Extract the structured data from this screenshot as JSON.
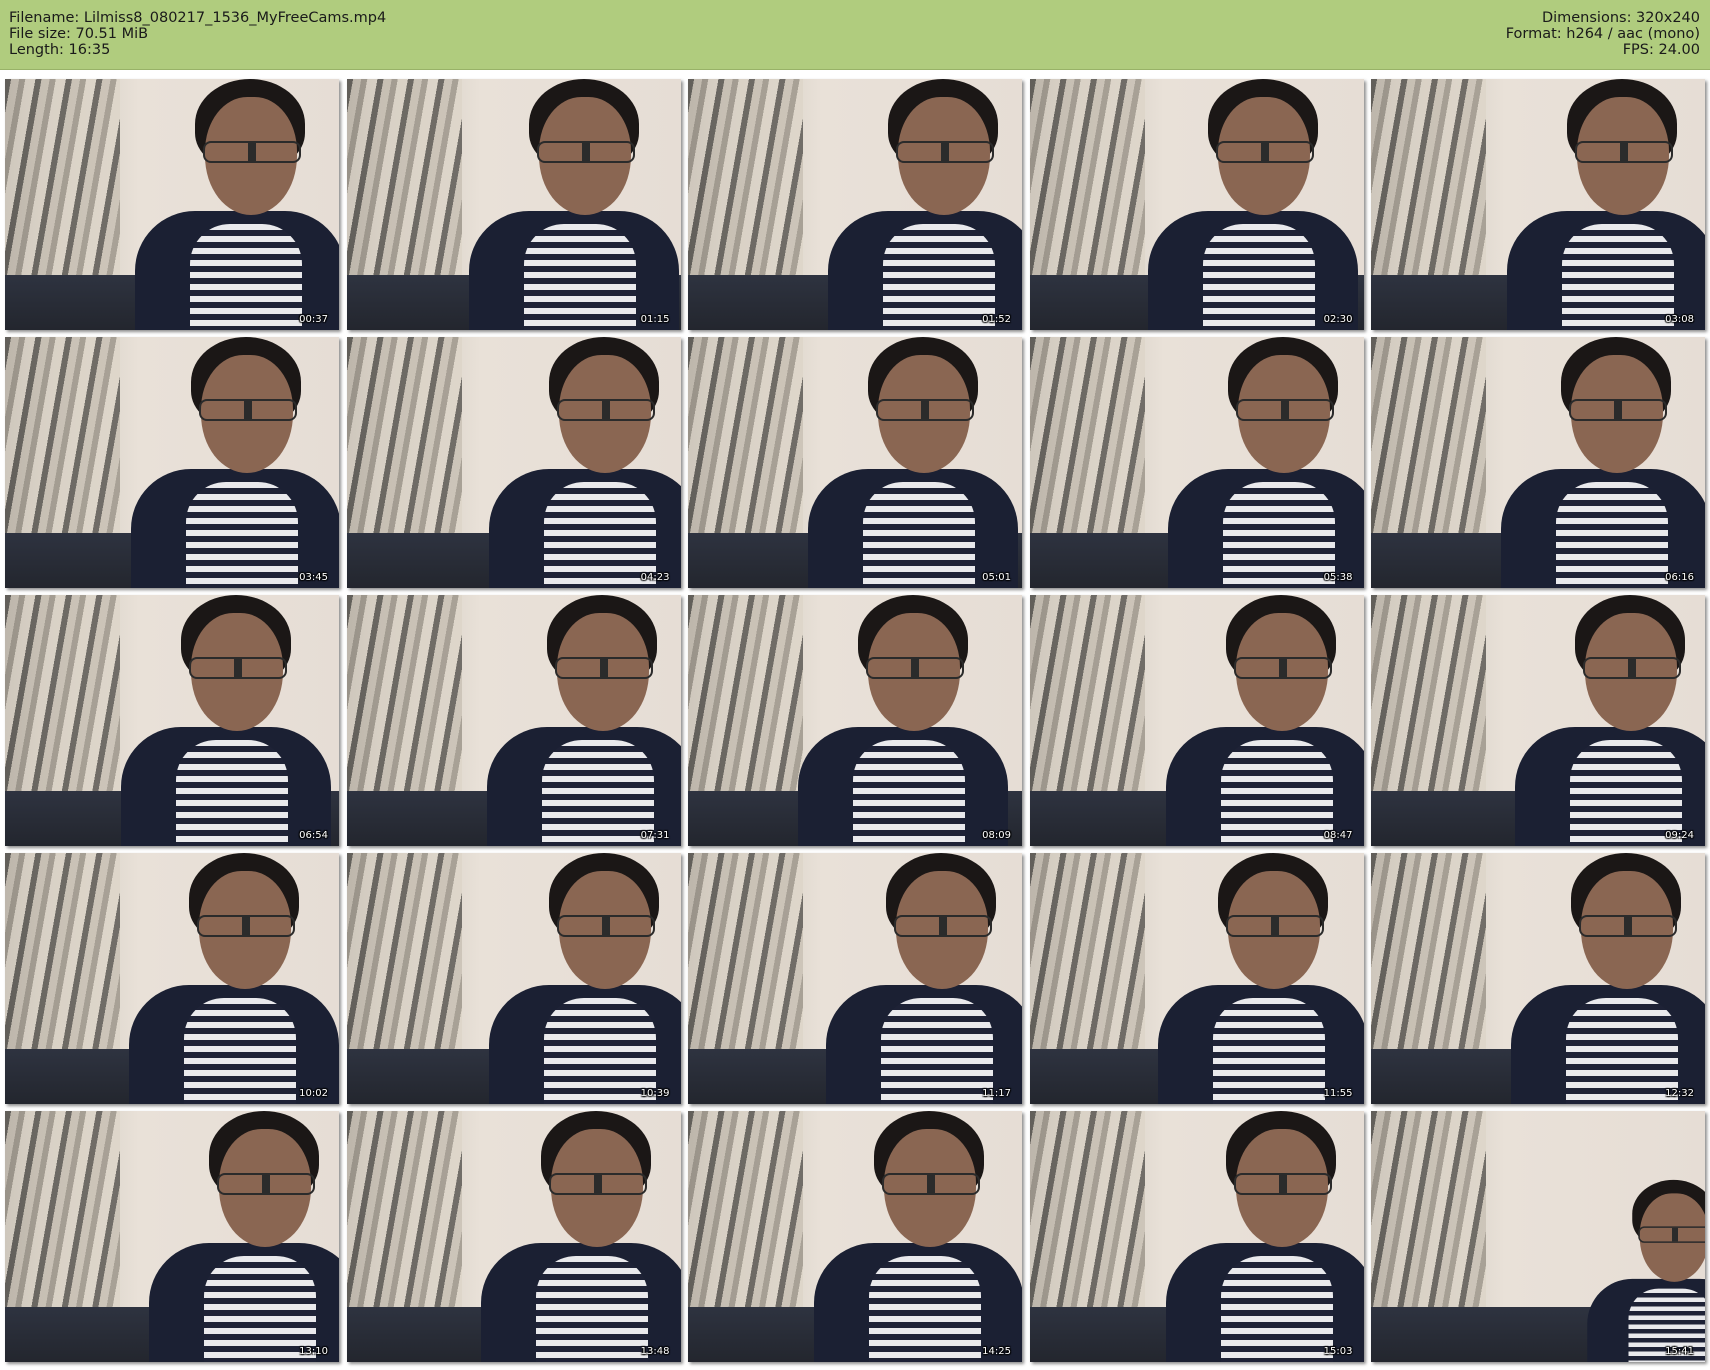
{
  "header": {
    "filename": "Filename: Lilmiss8_080217_1536_MyFreeCams.mp4",
    "file_size": "File size: 70.51 MiB",
    "length": "Length: 16:35",
    "dimensions": "Dimensions: 320x240",
    "format": "Format: h264 / aac (mono)",
    "fps": "FPS: 24.00"
  },
  "thumbnails": [
    {
      "time": "00:37"
    },
    {
      "time": "01:15"
    },
    {
      "time": "01:52"
    },
    {
      "time": "02:30"
    },
    {
      "time": "03:08"
    },
    {
      "time": "03:45"
    },
    {
      "time": "04:23"
    },
    {
      "time": "05:01"
    },
    {
      "time": "05:38"
    },
    {
      "time": "06:16"
    },
    {
      "time": "06:54"
    },
    {
      "time": "07:31"
    },
    {
      "time": "08:09"
    },
    {
      "time": "08:47"
    },
    {
      "time": "09:24"
    },
    {
      "time": "10:02"
    },
    {
      "time": "10:39"
    },
    {
      "time": "11:17"
    },
    {
      "time": "11:55"
    },
    {
      "time": "12:32"
    },
    {
      "time": "13:10"
    },
    {
      "time": "13:48"
    },
    {
      "time": "14:25"
    },
    {
      "time": "15:03"
    },
    {
      "time": "15:41"
    }
  ]
}
